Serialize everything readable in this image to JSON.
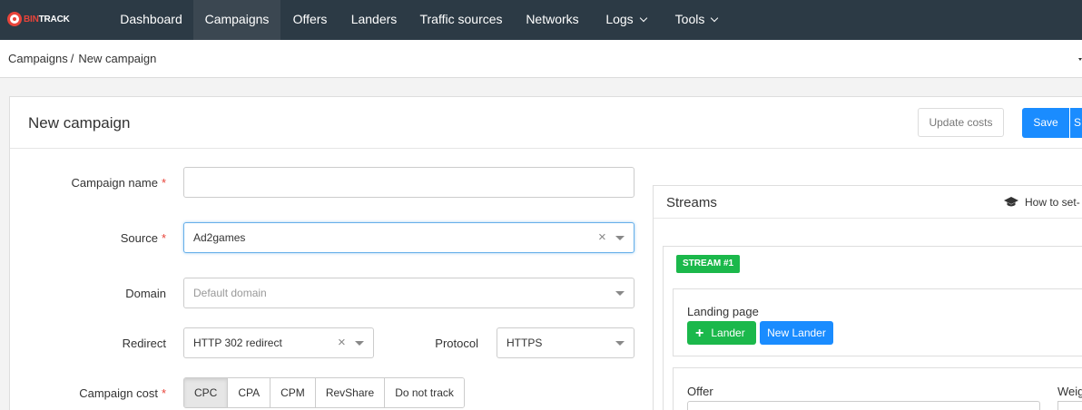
{
  "logo": {
    "text_red": "BIN",
    "text_white": "TRACK"
  },
  "nav": {
    "items": [
      {
        "label": "Dashboard"
      },
      {
        "label": "Campaigns"
      },
      {
        "label": "Offers"
      },
      {
        "label": "Landers"
      },
      {
        "label": "Traffic sources"
      },
      {
        "label": "Networks"
      },
      {
        "label": "Logs"
      },
      {
        "label": "Tools"
      }
    ]
  },
  "breadcrumb": {
    "parent": "Campaigns",
    "separator": "/",
    "current": "New campaign"
  },
  "panel": {
    "title": "New campaign",
    "update_costs_label": "Update costs",
    "save_label": "Save",
    "save2_label": "S"
  },
  "form": {
    "campaign_name": {
      "label": "Campaign name",
      "required_mark": "*",
      "value": ""
    },
    "source": {
      "label": "Source",
      "required_mark": "*",
      "value": "Ad2games"
    },
    "domain": {
      "label": "Domain",
      "placeholder": "Default domain"
    },
    "redirect": {
      "label": "Redirect",
      "value": "HTTP 302 redirect"
    },
    "protocol": {
      "label": "Protocol",
      "value": "HTTPS"
    },
    "campaign_cost": {
      "label": "Campaign cost",
      "required_mark": "*",
      "options": [
        "CPC",
        "CPA",
        "CPM",
        "RevShare",
        "Do not track"
      ],
      "selected": "CPC"
    }
  },
  "streams": {
    "title": "Streams",
    "howto_label": "How to set-",
    "stream_badge": "STREAM #1",
    "landing_title": "Landing page",
    "lander_button": "Lander",
    "new_lander_button": "New Lander",
    "offer_title": "Offer",
    "weight_title": "Weig"
  },
  "colors": {
    "nav_bg": "#2c3a45",
    "accent_blue": "#1a8cff",
    "accent_green": "#1bb84b",
    "required_red": "#e8443a"
  }
}
